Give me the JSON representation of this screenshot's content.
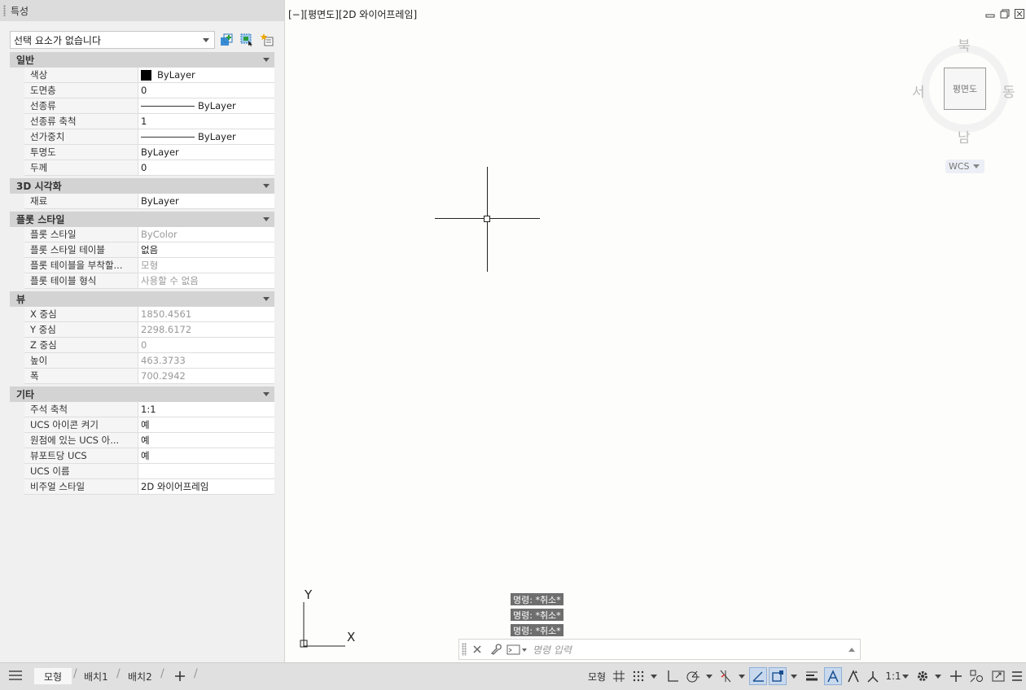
{
  "properties_panel": {
    "title": "특성",
    "selection": "선택 요소가 없습니다",
    "sections": [
      {
        "name": "일반",
        "rows": [
          {
            "key": "색상",
            "value": "ByLayer",
            "kind": "color"
          },
          {
            "key": "도면층",
            "value": "0"
          },
          {
            "key": "선종류",
            "value": "ByLayer",
            "kind": "line"
          },
          {
            "key": "선종류 축척",
            "value": "1"
          },
          {
            "key": "선가중치",
            "value": "ByLayer",
            "kind": "line"
          },
          {
            "key": "투명도",
            "value": "ByLayer"
          },
          {
            "key": "두께",
            "value": "0"
          }
        ]
      },
      {
        "name": "3D 시각화",
        "rows": [
          {
            "key": "재료",
            "value": "ByLayer"
          }
        ]
      },
      {
        "name": "플롯 스타일",
        "rows": [
          {
            "key": "플롯 스타일",
            "value": "ByColor",
            "dim": true
          },
          {
            "key": "플롯 스타일 테이블",
            "value": "없음"
          },
          {
            "key": "플롯 테이블을 부착할...",
            "value": "모형",
            "dim": true
          },
          {
            "key": "플롯 테이블 형식",
            "value": "사용할 수 없음",
            "dim": true
          }
        ]
      },
      {
        "name": "뷰",
        "rows": [
          {
            "key": "X 중심",
            "value": "1850.4561",
            "dim": true
          },
          {
            "key": "Y 중심",
            "value": "2298.6172",
            "dim": true
          },
          {
            "key": "Z 중심",
            "value": "0",
            "dim": true
          },
          {
            "key": "높이",
            "value": "463.3733",
            "dim": true
          },
          {
            "key": "폭",
            "value": "700.2942",
            "dim": true
          }
        ]
      },
      {
        "name": "기타",
        "rows": [
          {
            "key": "주석 축척",
            "value": "1:1"
          },
          {
            "key": "UCS 아이콘 켜기",
            "value": "예"
          },
          {
            "key": "원점에 있는 UCS 아...",
            "value": "예"
          },
          {
            "key": "뷰포트당 UCS",
            "value": "예"
          },
          {
            "key": "UCS 이름",
            "value": ""
          },
          {
            "key": "비주얼 스타일",
            "value": "2D 와이어프레임"
          }
        ]
      }
    ]
  },
  "viewport": {
    "label": "[−][평면도][2D 와이어프레임]",
    "viewcube": {
      "north": "북",
      "south": "남",
      "east": "동",
      "west": "서",
      "face": "평면도",
      "wcs": "WCS"
    },
    "ucs_x": "X",
    "ucs_y": "Y"
  },
  "command": {
    "history": [
      "명령: *취소*",
      "명령: *취소*",
      "명령: *취소*"
    ],
    "placeholder": "명령 입력"
  },
  "status_bar": {
    "tabs": [
      "모형",
      "배치1",
      "배치2"
    ],
    "model_label": "모형",
    "scale_label": "1:1"
  }
}
